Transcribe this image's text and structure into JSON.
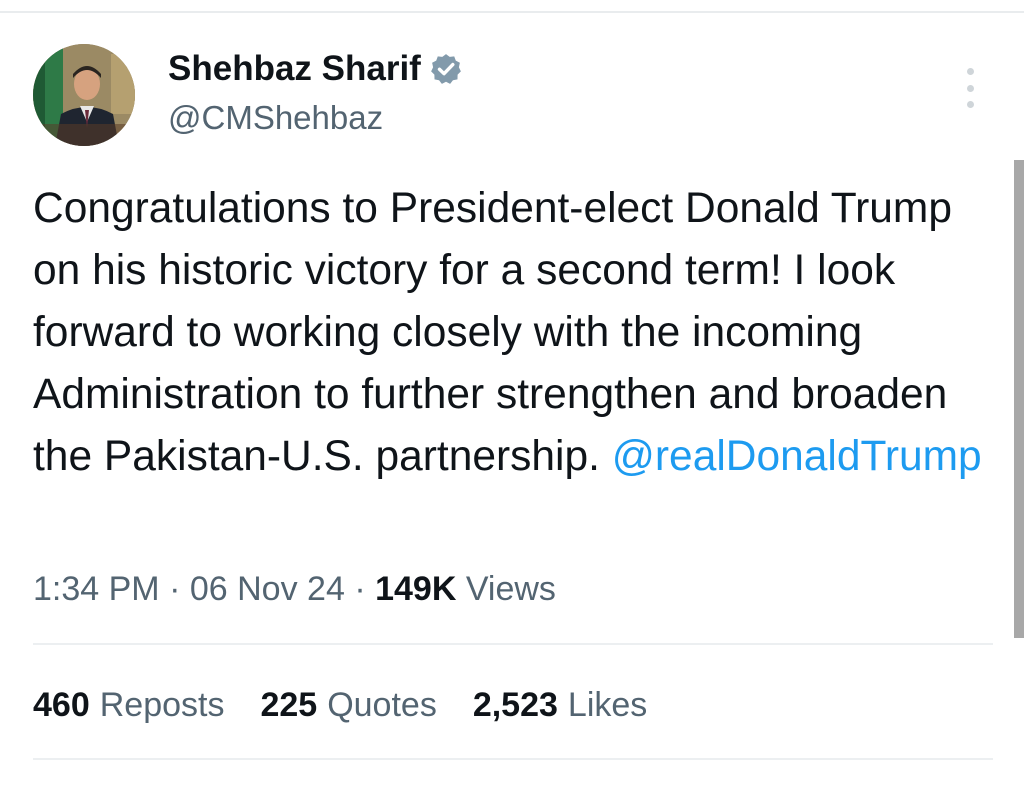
{
  "author": {
    "display_name": "Shehbaz Sharif",
    "handle": "@CMShehbaz",
    "verified": true
  },
  "tweet": {
    "text": "Congratulations to President-elect Donald Trump on his historic victory for a second term! I look forward to working closely with the incoming Administration to further strengthen and broaden the Pakistan-U.S. partnership.",
    "mention": "@realDonaldTrump"
  },
  "meta": {
    "time": "1:34 PM",
    "date": "06 Nov 24",
    "separator": "·",
    "views_count": "149K",
    "views_label": "Views"
  },
  "stats": {
    "reposts_count": "460",
    "reposts_label": "Reposts",
    "quotes_count": "225",
    "quotes_label": "Quotes",
    "likes_count": "2,523",
    "likes_label": "Likes"
  },
  "icons": {
    "verified": "verified-badge-icon",
    "more": "more-options-icon"
  },
  "colors": {
    "accent": "#1d9bf0",
    "text_primary": "#0f1419",
    "text_secondary": "#536471",
    "verified_badge": "#829aab"
  }
}
